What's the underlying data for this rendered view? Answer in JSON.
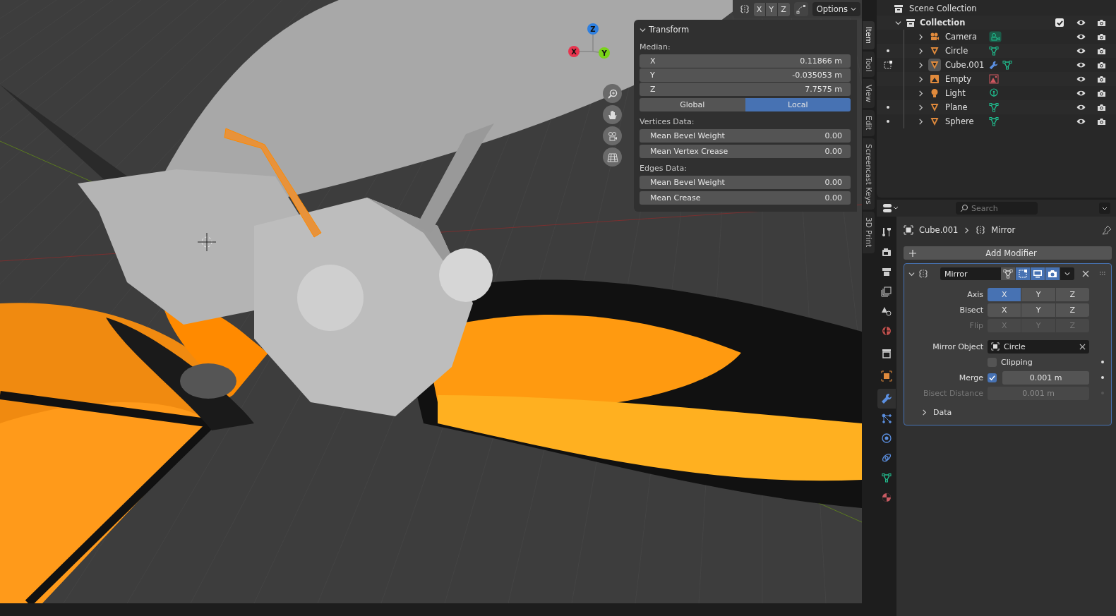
{
  "viewport": {
    "header": {
      "axis_toggles": [
        "X",
        "Y",
        "Z"
      ],
      "options": "Options"
    },
    "gizmo": [
      {
        "label": "Z",
        "color": "#2f80e0"
      },
      {
        "label": "X",
        "color": "#e8344e"
      },
      {
        "label": "Y",
        "color": "#7ad41a"
      }
    ],
    "transform_panel": {
      "title": "Transform",
      "median_label": "Median:",
      "coords": [
        {
          "axis": "X",
          "value": "0.11866 m"
        },
        {
          "axis": "Y",
          "value": "-0.035053 m"
        },
        {
          "axis": "Z",
          "value": "7.7575 m"
        }
      ],
      "space": [
        {
          "label": "Global",
          "selected": false
        },
        {
          "label": "Local",
          "selected": true
        }
      ],
      "sections": [
        {
          "title": "Vertices Data:",
          "fields": [
            {
              "label": "Mean Bevel Weight",
              "value": "0.00"
            },
            {
              "label": "Mean Vertex Crease",
              "value": "0.00"
            }
          ]
        },
        {
          "title": "Edges Data:",
          "fields": [
            {
              "label": "Mean Bevel Weight",
              "value": "0.00"
            },
            {
              "label": "Mean Crease",
              "value": "0.00"
            }
          ]
        }
      ]
    },
    "side_tabs": [
      {
        "label": "Item",
        "selected": true
      },
      {
        "label": "Tool",
        "selected": false
      },
      {
        "label": "View",
        "selected": false
      },
      {
        "label": "Edit",
        "selected": false
      },
      {
        "label": "Screencast Keys",
        "selected": false
      },
      {
        "label": "3D Print",
        "selected": false
      }
    ]
  },
  "outliner": {
    "root": "Scene Collection",
    "collection": {
      "label": "Collection",
      "expanded": true,
      "checked": true,
      "children": [
        {
          "name": "Camera",
          "kind": "camera",
          "active": false,
          "dot": false,
          "edit_mode": false,
          "modifier": false
        },
        {
          "name": "Circle",
          "kind": "mesh",
          "active": false,
          "dot": true,
          "edit_mode": false,
          "modifier": false
        },
        {
          "name": "Cube.001",
          "kind": "mesh",
          "active": true,
          "dot": false,
          "edit_mode": true,
          "modifier": true
        },
        {
          "name": "Empty",
          "kind": "empty",
          "active": false,
          "dot": false,
          "edit_mode": false,
          "modifier": false
        },
        {
          "name": "Light",
          "kind": "light",
          "active": false,
          "dot": false,
          "edit_mode": false,
          "modifier": false
        },
        {
          "name": "Plane",
          "kind": "mesh",
          "active": false,
          "dot": true,
          "edit_mode": false,
          "modifier": false
        },
        {
          "name": "Sphere",
          "kind": "mesh",
          "active": false,
          "dot": true,
          "edit_mode": false,
          "modifier": false
        }
      ]
    }
  },
  "properties": {
    "search": {
      "placeholder": "Search"
    },
    "tabs": [
      {
        "kind": "tool",
        "selected": false
      },
      {
        "kind": "render",
        "selected": false
      },
      {
        "kind": "output",
        "selected": false
      },
      {
        "kind": "view_layer",
        "selected": false
      },
      {
        "kind": "scene",
        "selected": false
      },
      {
        "kind": "world",
        "selected": false
      },
      {
        "kind": "collection",
        "selected": false
      },
      {
        "kind": "object",
        "selected": false
      },
      {
        "kind": "modifiers",
        "selected": true
      },
      {
        "kind": "particles",
        "selected": false
      },
      {
        "kind": "physics",
        "selected": false
      },
      {
        "kind": "constraints",
        "selected": false
      },
      {
        "kind": "data",
        "selected": false
      },
      {
        "kind": "material",
        "selected": false
      }
    ],
    "breadcrumb": [
      "Cube.001",
      "Mirror"
    ],
    "add_modifier": "Add Modifier",
    "modifier": {
      "name": "Mirror",
      "expanded": true,
      "toggles": [
        {
          "kind": "edit_mode",
          "on": false
        },
        {
          "kind": "cage",
          "on": true
        },
        {
          "kind": "viewport",
          "on": true
        },
        {
          "kind": "render",
          "on": true
        }
      ],
      "axis_rows": [
        {
          "label": "Axis",
          "disabled": false,
          "buttons": [
            {
              "label": "X",
              "selected": true
            },
            {
              "label": "Y",
              "selected": false
            },
            {
              "label": "Z",
              "selected": false
            }
          ]
        },
        {
          "label": "Bisect",
          "disabled": false,
          "buttons": [
            {
              "label": "X",
              "selected": false
            },
            {
              "label": "Y",
              "selected": false
            },
            {
              "label": "Z",
              "selected": false
            }
          ]
        },
        {
          "label": "Flip",
          "disabled": true,
          "buttons": [
            {
              "label": "X",
              "selected": false
            },
            {
              "label": "Y",
              "selected": false
            },
            {
              "label": "Z",
              "selected": false
            }
          ]
        }
      ],
      "mirror_object": {
        "label": "Mirror Object",
        "value": "Circle"
      },
      "clipping": {
        "label": "Clipping",
        "checked": false
      },
      "merge": {
        "label": "Merge",
        "checked": true,
        "value": "0.001 m"
      },
      "bisect_distance": {
        "label": "Bisect Distance",
        "value": "0.001 m",
        "disabled": true
      },
      "data": {
        "label": "Data",
        "expanded": false
      }
    }
  }
}
